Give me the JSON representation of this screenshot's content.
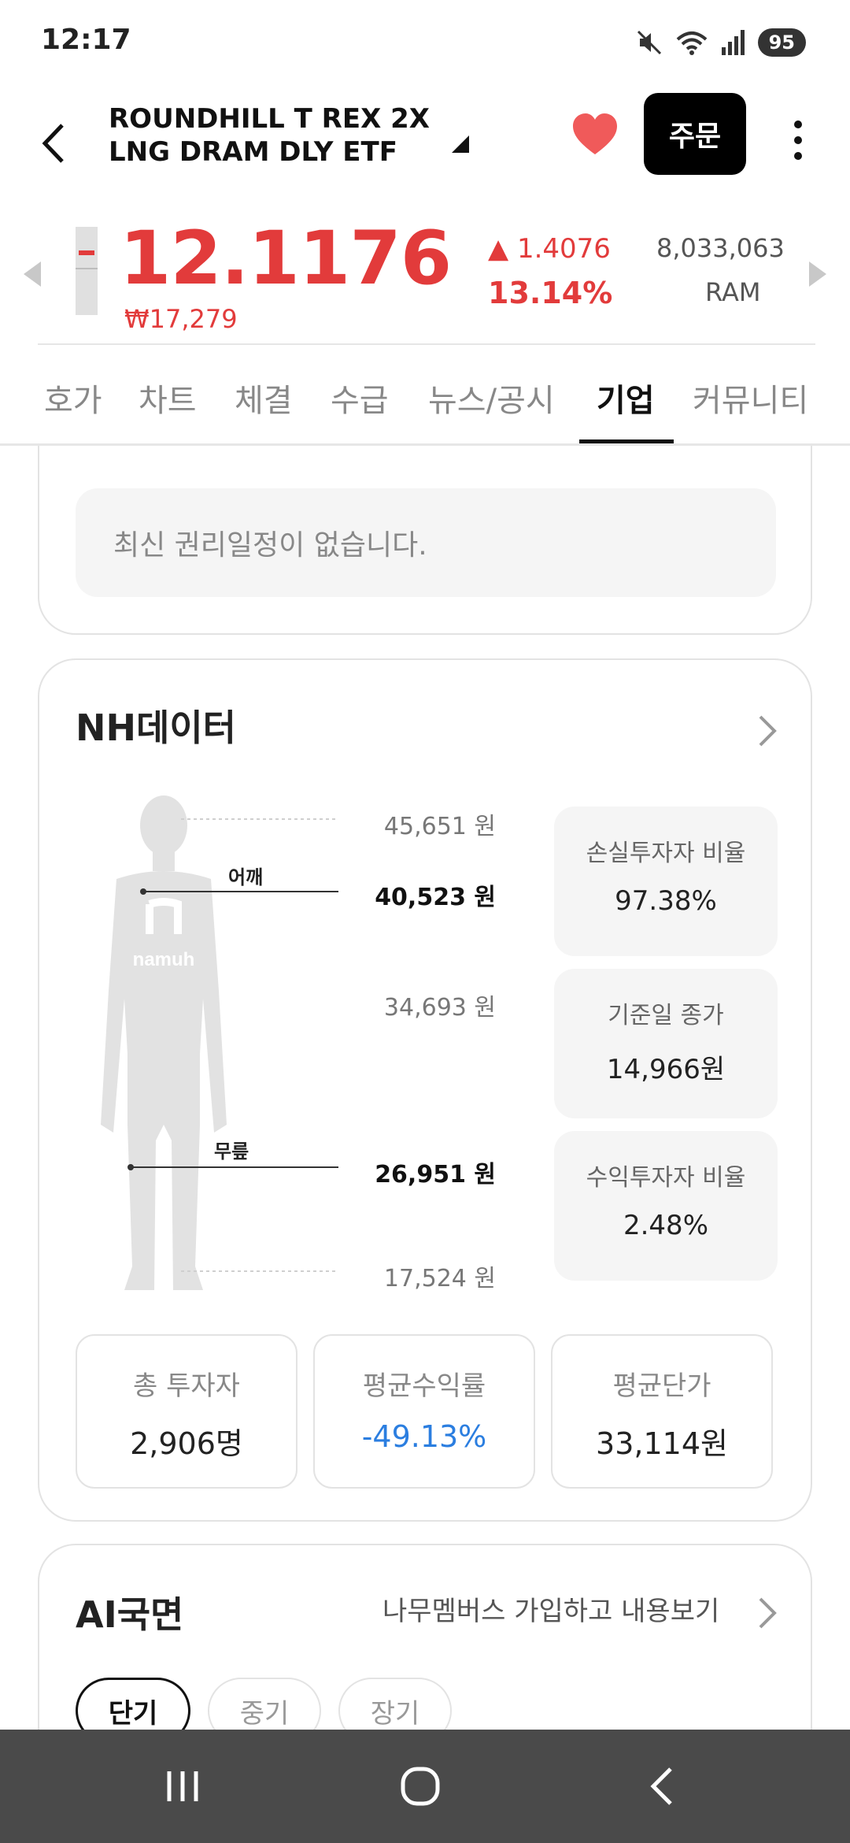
{
  "status_bar": {
    "time": "12:17",
    "battery": "95"
  },
  "header": {
    "title": "ROUNDHILL T REX 2X LNG DRAM DLY ETF",
    "order_label": "주문"
  },
  "quote": {
    "price": "12.1176",
    "price_krw": "₩17,279",
    "change": "▲ 1.4076",
    "change_pct": "13.14%",
    "volume": "8,033,063",
    "volume_unit": "RAM",
    "up_color": "#e23b3b"
  },
  "tabs": [
    "호가",
    "차트",
    "체결",
    "수급",
    "뉴스/공시",
    "기업",
    "커뮤니티"
  ],
  "active_tab": "기업",
  "rights": {
    "empty_message": "최신 권리일정이 없습니다."
  },
  "nh_data": {
    "title": "NH데이터",
    "brand": "namuh",
    "shoulder_tag": "어깨",
    "knee_tag": "무릎",
    "levels": {
      "top": "45,651 원",
      "shoulder": "40,523 원",
      "mid": "34,693 원",
      "knee": "26,951 원",
      "bottom": "17,524 원"
    },
    "stats": [
      {
        "label": "손실투자자 비율",
        "value": "97.38%"
      },
      {
        "label": "기준일 종가",
        "value": "14,966원"
      },
      {
        "label": "수익투자자 비율",
        "value": "2.48%"
      }
    ],
    "summary": [
      {
        "label": "총 투자자",
        "value": "2,906명"
      },
      {
        "label": "평균수익률",
        "value": "-49.13%"
      },
      {
        "label": "평균단가",
        "value": "33,114원"
      }
    ],
    "negative_color": "#2b7ee0"
  },
  "ai_section": {
    "title": "AI국면",
    "link": "나무멤버스 가입하고 내용보기",
    "periods": [
      "단기",
      "중기",
      "장기"
    ],
    "active_period": "단기"
  }
}
